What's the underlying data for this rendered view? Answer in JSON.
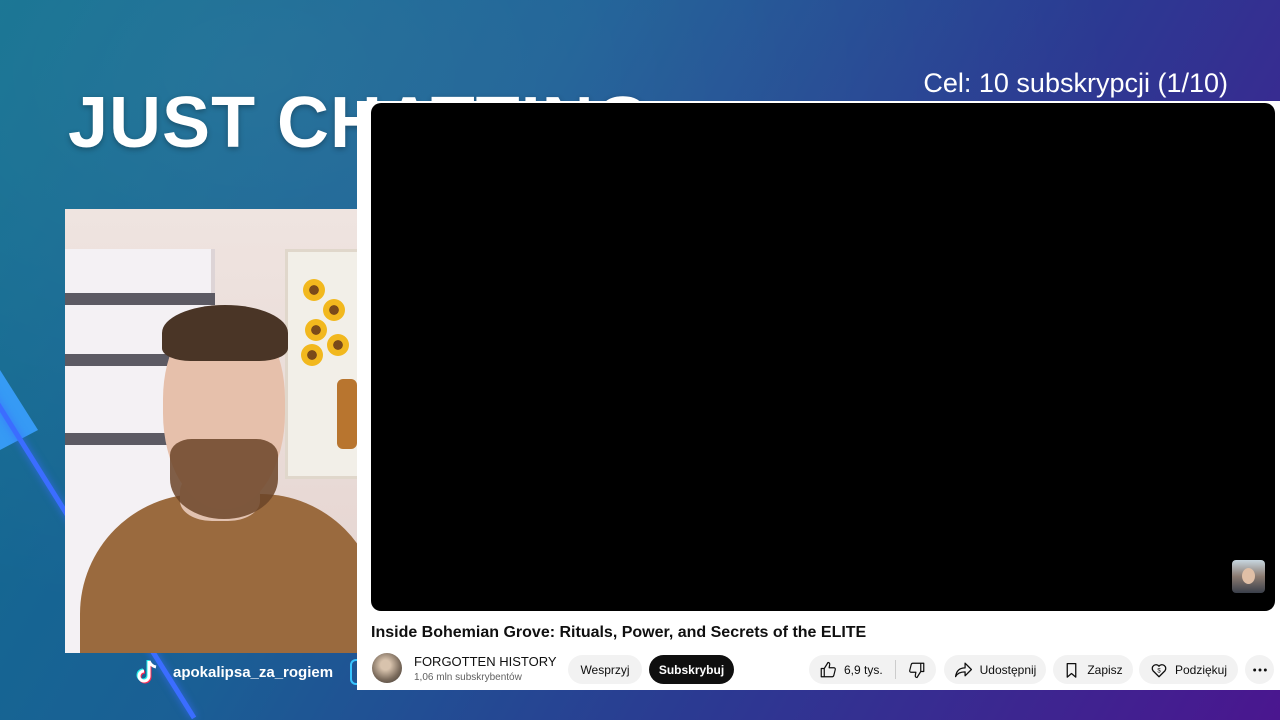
{
  "overlay": {
    "scene_title": "JUST CHATTING",
    "goal": "Cel: 10 subskrypcji (1/10)",
    "social": {
      "platform_icon": "tiktok-icon",
      "handle": "apokalipsa_za_rogiem"
    },
    "colors": {
      "accent": "#3b6dff",
      "bg_start": "#0f6f8f",
      "bg_end": "#4a168f"
    }
  },
  "youtube": {
    "video_title": "Inside Bohemian Grove: Rituals, Power, and Secrets of the ELITE",
    "channel_name": "FORGOTTEN HISTORY",
    "channel_subs": "1,06 mln subskrybentów",
    "support_label": "Wesprzyj",
    "subscribe_label": "Subskrybuj",
    "like_count": "6,9 tys.",
    "share_label": "Udostępnij",
    "save_label": "Zapisz",
    "thanks_label": "Podziękuj",
    "icons": {
      "like": "thumbs-up-icon",
      "dislike": "thumbs-down-icon",
      "share": "share-icon",
      "save": "bookmark-icon",
      "thanks": "thanks-icon",
      "more": "more-icon"
    }
  }
}
